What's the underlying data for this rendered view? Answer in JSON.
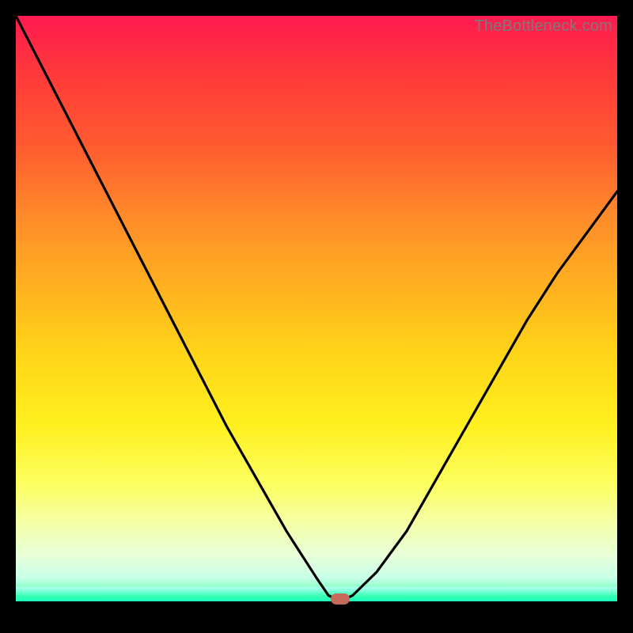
{
  "watermark": "TheBottleneck.com",
  "colors": {
    "frame": "#000000",
    "gradient_top": "#ff1a50",
    "gradient_bottom": "#3bff9a",
    "curve": "#000000",
    "marker": "#c56a5a"
  },
  "chart_data": {
    "type": "line",
    "title": "",
    "xlabel": "",
    "ylabel": "",
    "xlim": [
      0,
      100
    ],
    "ylim": [
      0,
      100
    ],
    "grid": false,
    "series": [
      {
        "name": "bottleneck-curve",
        "x": [
          0,
          5,
          10,
          15,
          20,
          25,
          30,
          35,
          40,
          45,
          50,
          52,
          54,
          56,
          60,
          65,
          70,
          75,
          80,
          85,
          90,
          95,
          100
        ],
        "y": [
          100,
          90,
          80,
          70,
          60,
          50,
          40,
          30,
          21,
          12,
          4,
          1,
          0,
          1,
          5,
          12,
          21,
          30,
          39,
          48,
          56,
          63,
          70
        ]
      }
    ],
    "annotations": [
      {
        "type": "marker",
        "x": 54,
        "y": 0,
        "label": "optimal-point"
      }
    ]
  }
}
